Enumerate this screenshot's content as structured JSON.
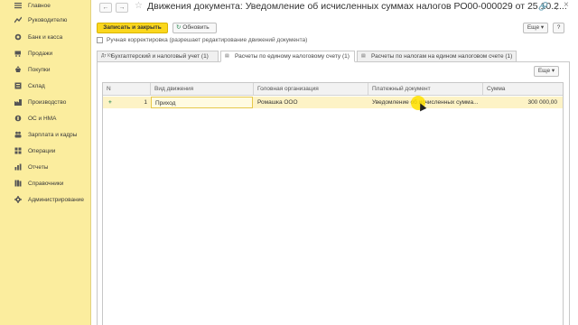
{
  "sidebar": {
    "items": [
      {
        "label": "Главное",
        "icon": "menu-icon"
      },
      {
        "label": "Руководителю",
        "icon": "trend-icon"
      },
      {
        "label": "Банк и касса",
        "icon": "coins-icon"
      },
      {
        "label": "Продажи",
        "icon": "cart-icon"
      },
      {
        "label": "Покупки",
        "icon": "basket-icon"
      },
      {
        "label": "Склад",
        "icon": "warehouse-icon"
      },
      {
        "label": "Производство",
        "icon": "factory-icon"
      },
      {
        "label": "ОС и НМА",
        "icon": "assets-icon"
      },
      {
        "label": "Зарплата и кадры",
        "icon": "people-icon"
      },
      {
        "label": "Операции",
        "icon": "operations-icon"
      },
      {
        "label": "Отчеты",
        "icon": "reports-icon"
      },
      {
        "label": "Справочники",
        "icon": "books-icon"
      },
      {
        "label": "Администрирование",
        "icon": "gear-icon"
      }
    ]
  },
  "header": {
    "back": "←",
    "forward": "→",
    "title": "Движения документа: Уведомление об исчисленных суммах налогов РО00-000029 от 25.10.2...",
    "link_icon": "🔗",
    "more_icon": "⋮",
    "close_icon": "×"
  },
  "toolbar": {
    "save_close": "Записать и закрыть",
    "refresh": "Обновить",
    "more": "Еще ▾",
    "help": "?"
  },
  "manual_correction_label": "Ручная корректировка (разрешает редактирование движений документа)",
  "tabs": [
    {
      "label": "Бухгалтерский и налоговый учет (1)",
      "icon": "Дт Кт"
    },
    {
      "label": "Расчеты по единому налоговому счету (1)",
      "icon": "▤"
    },
    {
      "label": "Расчеты по налогам на едином налоговом счете (1)",
      "icon": "▤"
    }
  ],
  "panel": {
    "more": "Еще ▾"
  },
  "table": {
    "columns": [
      "N",
      "Вид движения",
      "Головная организация",
      "Платежный документ",
      "Сумма"
    ],
    "rows": [
      {
        "marker": "+",
        "n": "1",
        "movement": "Приход",
        "org": "Ромашка ООО",
        "doc": "Уведомление об исчисленных сумма...",
        "sum": "300 000,00"
      }
    ]
  }
}
